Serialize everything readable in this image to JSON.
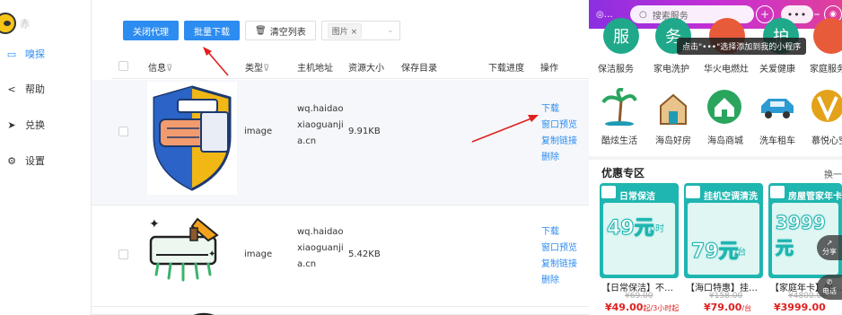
{
  "sidebar": {
    "brand": "赤",
    "items": [
      {
        "icon": "radar-icon",
        "glyph": "▭",
        "label": "嗅探"
      },
      {
        "icon": "share-icon",
        "glyph": "<",
        "label": "帮助"
      },
      {
        "icon": "send-icon",
        "glyph": "➤",
        "label": "兑换"
      },
      {
        "icon": "gear-icon",
        "glyph": "⚙",
        "label": "设置"
      }
    ]
  },
  "toolbar": {
    "close_proxy": "关闭代理",
    "batch_download": "批量下载",
    "clear_list": "清空列表",
    "filter_tag": "图片",
    "filter_tag_close": "×"
  },
  "table": {
    "headers": {
      "info": "信息",
      "type": "类型",
      "host": "主机地址",
      "size": "资源大小",
      "save_dir": "保存目录",
      "progress": "下载进度",
      "action": "操作"
    },
    "filter_mark": "⊽",
    "rows": [
      {
        "type": "image",
        "host": "wq.haidaoxiaoguanjia.cn",
        "size": "9.91KB",
        "actions": [
          "下载",
          "窗口预览",
          "复制链接",
          "删除"
        ]
      },
      {
        "type": "image",
        "host": "wq.haidaoxiaoguanjia.cn",
        "size": "5.42KB",
        "actions": [
          "下载",
          "窗口预览",
          "复制链接",
          "删除"
        ]
      }
    ]
  },
  "panel": {
    "search_placeholder": "搜索服务",
    "tooltip": "点击\"•••\"选择添加到我的小程序",
    "services_row1": [
      {
        "label": "保洁服务",
        "glyph": "服",
        "color": "#1fa98a"
      },
      {
        "label": "家电洗护",
        "glyph": "务",
        "color": "#1fa98a"
      },
      {
        "label": "华火电燃灶",
        "glyph": "",
        "color": "#e85b3a"
      },
      {
        "label": "关爱健康",
        "glyph": "护",
        "color": "#1fa98a"
      },
      {
        "label": "家庭服务",
        "glyph": "",
        "color": "#e85b3a"
      }
    ],
    "services_row2": [
      {
        "label": "酷炫生活",
        "color": "#1f9bb5"
      },
      {
        "label": "海岛好房",
        "color": "#1f9bb5"
      },
      {
        "label": "海岛商城",
        "color": "#2aa55e"
      },
      {
        "label": "洗车租车",
        "color": "#2c9bd3"
      },
      {
        "label": "慕悦心空",
        "color": "#e3a21a"
      }
    ],
    "promo_title": "优惠专区",
    "promo_more": "换一",
    "promos": [
      {
        "badge": "日常保洁",
        "price": "49元",
        "unit": "小时",
        "name": "【日常保洁】不…",
        "old": "¥69.00",
        "new": "¥49.00",
        "suffix": "起/3小时起"
      },
      {
        "badge": "挂机空调清洗",
        "price": "79元",
        "unit": "/台",
        "name": "【海口特惠】挂…",
        "old": "¥158.00",
        "new": "¥79.00",
        "suffix": "/台"
      },
      {
        "badge": "房屋管家年卡",
        "price": "3999元",
        "unit": "",
        "name": "【家庭年卡】保…",
        "old": "¥4800.00",
        "new": "¥3999.00",
        "suffix": ""
      }
    ],
    "float_share": "分享",
    "float_phone": "电话"
  }
}
